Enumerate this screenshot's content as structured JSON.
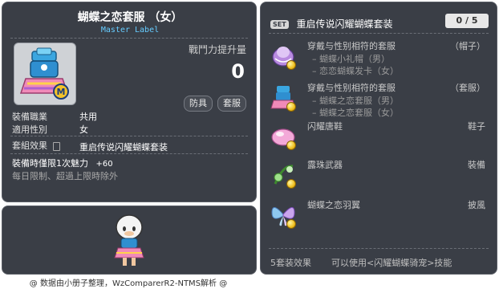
{
  "corner_id": "01051750",
  "item": {
    "name": "蝴蝶之恋套服 （女）",
    "subtitle": "Master Label",
    "power_label": "戰鬥力提升量",
    "power_value": "0",
    "tags": [
      "防具",
      "套服"
    ],
    "job_label": "裝備職業",
    "job_value": "共用",
    "gender_label": "適用性別",
    "gender_value": "女",
    "set_effect_label": "套組效果",
    "set_effect_value": "重启传说闪耀蝴蝶套装",
    "time_limit": "裝備時僅限1次魅力",
    "time_limit_bonus": "+60",
    "reset_note": "每日限制、超過上限時除外"
  },
  "set": {
    "badge": "SET",
    "title": "重启传说闪耀蝴蝶套装",
    "count": "0 / 5",
    "items": [
      {
        "name": "穿戴与性别相符的套服",
        "type": "（帽子）",
        "subs": [
          "– 蝴蝶小礼帽（男）",
          "– 恋恋蝴蝶发卡（女）"
        ],
        "icon": "butterfly-hat-icon"
      },
      {
        "name": "穿戴与性别相符的套服",
        "type": "（套服）",
        "subs": [
          "– 蝴蝶之恋套服（男）",
          "– 蝴蝶之恋套服（女）"
        ],
        "icon": "butterfly-suit-icon"
      },
      {
        "name": "闪耀唐鞋",
        "type": "鞋子",
        "subs": [],
        "icon": "shoes-icon"
      },
      {
        "name": "露珠武器",
        "type": "裝備",
        "subs": [],
        "icon": "dew-weapon-icon"
      },
      {
        "name": "蝴蝶之恋羽翼",
        "type": "披風",
        "subs": [],
        "icon": "butterfly-wings-icon"
      }
    ],
    "footer_left": "5套装效果",
    "footer_right": "可以使用<闪耀蝴蝶骑宠>技能"
  },
  "credit": "@ 数据由小册子整理，WzComparerR2-NTMS解析 @",
  "colors": {
    "panel_bg": "#3a3e46",
    "subtitle": "#66ccff",
    "coin": "#f0c020"
  }
}
